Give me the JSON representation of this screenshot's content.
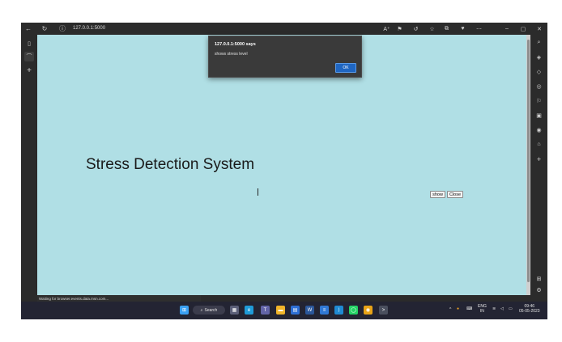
{
  "browser": {
    "url": "127.0.0.1:5000",
    "nav": {
      "back": "←",
      "refresh": "↻",
      "info": "ⓘ"
    },
    "toolbar_icons": [
      "A⁺",
      "⚑",
      "↺",
      "☆",
      "⧉",
      "♥",
      "⋯"
    ],
    "window_controls": [
      "–",
      "▢",
      "✕"
    ]
  },
  "left_tabs": [
    {
      "name": "tab-actions-icon",
      "glyph": "▯"
    },
    {
      "name": "active-tab-icon",
      "glyph": "⌒"
    },
    {
      "name": "new-tab-icon",
      "glyph": "+"
    }
  ],
  "page": {
    "title": "Stress Detection System",
    "show_button": "show",
    "close_button": "Close"
  },
  "alert": {
    "title": "127.0.0.1:5000 says",
    "message": "shows stress level",
    "ok": "OK"
  },
  "status": "Waiting for browser.events.data.msn.com...",
  "sidebar_icons": [
    "⌕",
    "◈",
    "◇",
    "◎",
    "⚐",
    "▣",
    "◉",
    "⌂",
    "+",
    "⊞",
    "⚙"
  ],
  "taskbar": {
    "search": "Search",
    "apps": [
      {
        "name": "start-icon",
        "color": "#3aa0f3",
        "glyph": "⊞"
      },
      {
        "name": "task-view-icon",
        "color": "#5b5f78",
        "glyph": "▦"
      },
      {
        "name": "edge-icon",
        "color": "#1f9bd8",
        "glyph": "e"
      },
      {
        "name": "teams-icon",
        "color": "#6264a7",
        "glyph": "T"
      },
      {
        "name": "file-explorer-icon",
        "color": "#f0b429",
        "glyph": "▬"
      },
      {
        "name": "store-icon",
        "color": "#2e6fd4",
        "glyph": "▤"
      },
      {
        "name": "word-icon",
        "color": "#2b579a",
        "glyph": "W"
      },
      {
        "name": "notepad-icon",
        "color": "#3078d4",
        "glyph": "≡"
      },
      {
        "name": "vscode-icon",
        "color": "#1f8ad2",
        "glyph": "⟩"
      },
      {
        "name": "whatsapp-icon",
        "color": "#25d366",
        "glyph": "◯"
      },
      {
        "name": "chrome-icon",
        "color": "#e8a317",
        "glyph": "◉"
      },
      {
        "name": "terminal-icon",
        "color": "#4a4f5e",
        "glyph": ">"
      }
    ],
    "tray": {
      "chevron": "^",
      "lang": "ENG",
      "region": "IN",
      "time": "09:46",
      "date": "05-05-2023"
    }
  },
  "colors": {
    "page_background": "#b0dfe5",
    "alert_ok": "#1f66c2",
    "chrome": "#2b2b2b",
    "taskbar": "#232433"
  }
}
